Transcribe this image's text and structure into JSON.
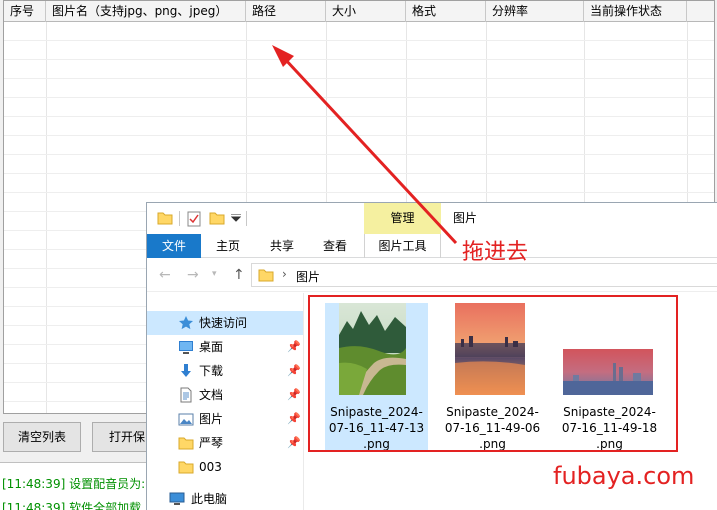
{
  "table": {
    "columns": [
      "序号",
      "图片名（支持jpg、png、jpeg）",
      "路径",
      "大小",
      "格式",
      "分辨率",
      "当前操作状态"
    ]
  },
  "buttons": {
    "clear_list": "清空列表",
    "open_save": "打开保"
  },
  "log": [
    "[11:48:39] 设置配音员为:",
    "[11:48:39] 软件全部加载"
  ],
  "explorer": {
    "context_tab": "管理",
    "context_tab_title": "图片",
    "ribbon_tabs": [
      "文件",
      "主页",
      "共享",
      "查看"
    ],
    "context_subtab": "图片工具",
    "breadcrumb_separator": "›",
    "breadcrumb": "图片",
    "sidebar": [
      {
        "label": "快速访问",
        "icon": "star-icon",
        "selected": true,
        "pinned": false
      },
      {
        "label": "桌面",
        "icon": "desktop-icon",
        "selected": false,
        "pinned": true
      },
      {
        "label": "下载",
        "icon": "download-icon",
        "selected": false,
        "pinned": true
      },
      {
        "label": "文档",
        "icon": "document-icon",
        "selected": false,
        "pinned": true
      },
      {
        "label": "图片",
        "icon": "pictures-icon",
        "selected": false,
        "pinned": true
      },
      {
        "label": "严琴",
        "icon": "folder-icon",
        "selected": false,
        "pinned": true
      },
      {
        "label": "003",
        "icon": "folder-icon",
        "selected": false,
        "pinned": false
      },
      {
        "label": "此电脑",
        "icon": "computer-icon",
        "selected": false,
        "pinned": false
      }
    ],
    "files": [
      {
        "lines": [
          "Snipaste_2024-",
          "07-16_11-47-13",
          ".png"
        ],
        "selected": true
      },
      {
        "lines": [
          "Snipaste_2024-",
          "07-16_11-49-06",
          ".png"
        ],
        "selected": false
      },
      {
        "lines": [
          "Snipaste_2024-",
          "07-16_11-49-18",
          ".png"
        ],
        "selected": false
      }
    ]
  },
  "annotations": {
    "drag_text": "拖进去",
    "watermark": "fubaya.com",
    "accent_color": "#e32222"
  }
}
